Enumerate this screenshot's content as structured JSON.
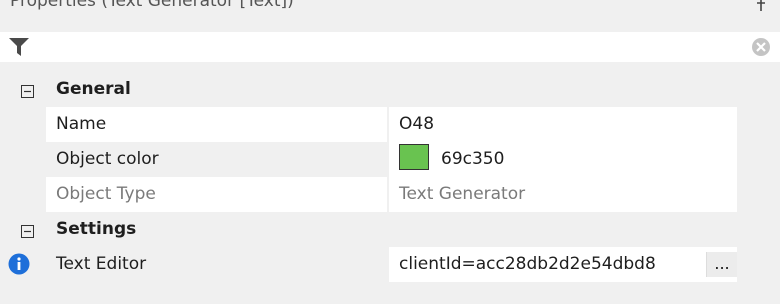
{
  "panel": {
    "title": "Properties (Text Generator [Text])",
    "pin_icon": "pin-icon"
  },
  "filter": {
    "filter_icon": "filter-icon",
    "value": "",
    "clear_icon": "clear-icon"
  },
  "categories": [
    {
      "label": "General",
      "toggle": "⊟",
      "properties": [
        {
          "name": "Name",
          "value": "O48",
          "readonly": false
        },
        {
          "name": "Object color",
          "value": "69c350",
          "swatch_color": "#69c350",
          "readonly": false
        },
        {
          "name": "Object Type",
          "value": "Text Generator",
          "readonly": true
        }
      ]
    },
    {
      "label": "Settings",
      "toggle": "⊟",
      "properties": [
        {
          "name": "Text Editor",
          "value": "clientId=acc28db2d2e54dbd8",
          "button_label": "...",
          "info_icon": "info-icon",
          "readonly": false
        }
      ]
    }
  ]
}
